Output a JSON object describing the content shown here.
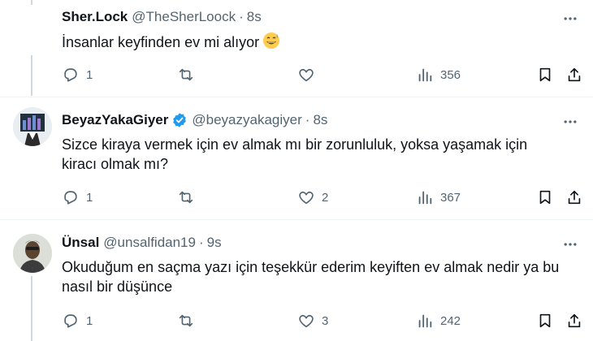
{
  "tweets": [
    {
      "name": "Sher.Lock",
      "handle": "@TheSherLoock",
      "separator": "·",
      "time": "8s",
      "text": "İnsanlar keyfinden ev mi alıyor",
      "emoji": "grinning-sweat-emoji",
      "verified": false,
      "replies": "1",
      "retweets": "",
      "likes": "",
      "views": "356"
    },
    {
      "name": "BeyazYakaGiyer",
      "handle": "@beyazyakagiyer",
      "separator": "·",
      "time": "8s",
      "text": "Sizce kiraya vermek için ev almak mı bir zorunluluk, yoksa yaşamak için kiracı olmak mı?",
      "verified": true,
      "replies": "1",
      "retweets": "",
      "likes": "2",
      "views": "367"
    },
    {
      "name": "Ünsal",
      "handle": "@unsalfidan19",
      "separator": "·",
      "time": "9s",
      "text": "Okuduğum en saçma yazı için teşekkür ederim keyiften ev almak nedir ya bu nasıl bir düşünce",
      "verified": false,
      "replies": "1",
      "retweets": "",
      "likes": "3",
      "views": "242"
    }
  ],
  "colors": {
    "text": "#0f1419",
    "secondary": "#536471",
    "verified": "#1d9bf0",
    "divider": "#eff3f4",
    "thread_line": "#cfd9de"
  }
}
